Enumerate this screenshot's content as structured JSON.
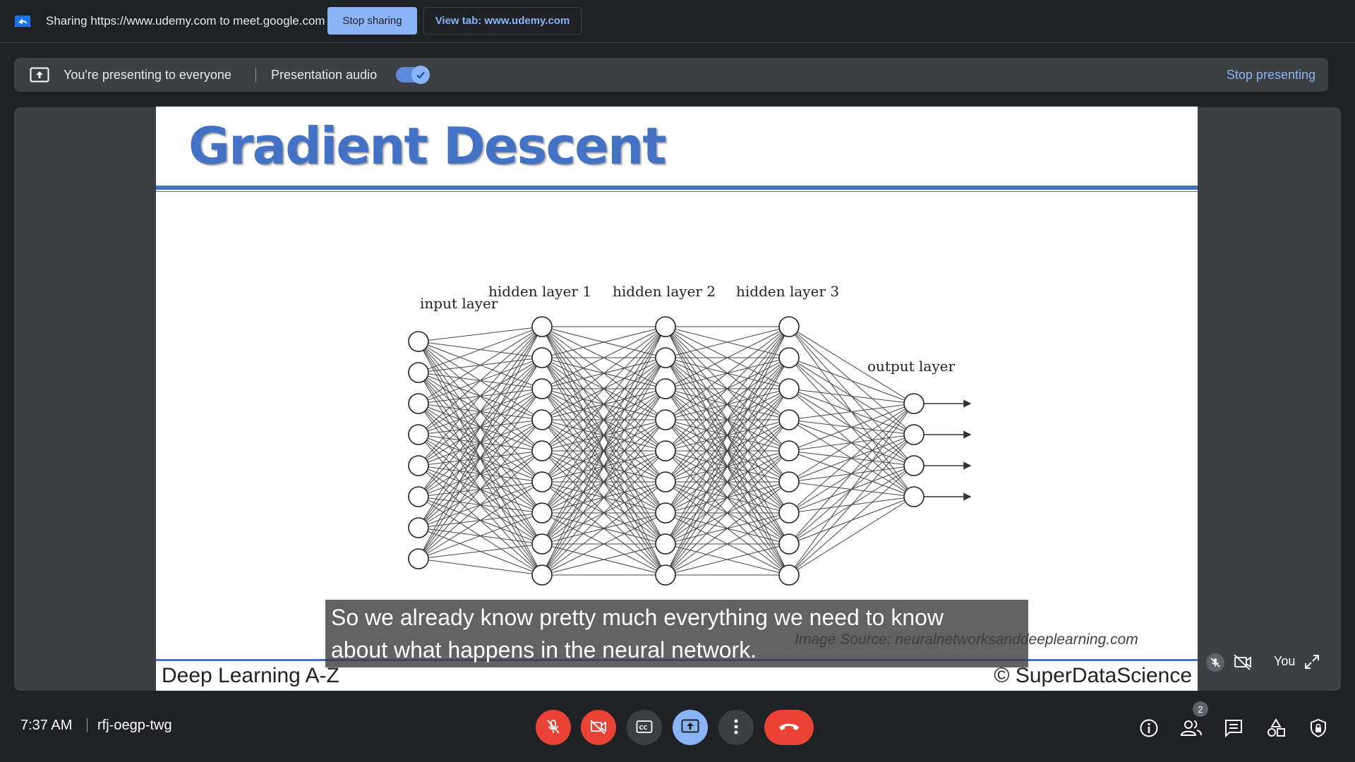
{
  "share_bar": {
    "text": "Sharing https://www.udemy.com to meet.google.com",
    "stop_sharing_label": "Stop sharing",
    "view_tab_label": "View tab: www.udemy.com"
  },
  "present_bar": {
    "text": "You're presenting to everyone",
    "audio_label": "Presentation audio",
    "audio_enabled": true,
    "stop_presenting_label": "Stop presenting"
  },
  "slide": {
    "title": "Gradient Descent",
    "layer_labels": {
      "input": "input layer",
      "hidden1": "hidden layer 1",
      "hidden2": "hidden layer 2",
      "hidden3": "hidden layer 3",
      "output": "output layer"
    },
    "layer_sizes": [
      8,
      9,
      9,
      9,
      4
    ],
    "image_source": "Image Source: neuralnetworksanddeeplearning.com",
    "footer_left": "Deep Learning A-Z",
    "footer_right": "© SuperDataScience"
  },
  "caption": {
    "line1": "So we already know pretty much everything we need to know",
    "line2": "about what happens in the neural network."
  },
  "self_tile": {
    "name": "You"
  },
  "bottom_bar": {
    "time": "7:37 AM",
    "meeting_code": "rfj-oegp-twg",
    "people_count": "2"
  },
  "colors": {
    "accent": "#8ab4f8",
    "danger": "#ea4335",
    "slide_blue": "#4472c4",
    "background": "#202124"
  }
}
